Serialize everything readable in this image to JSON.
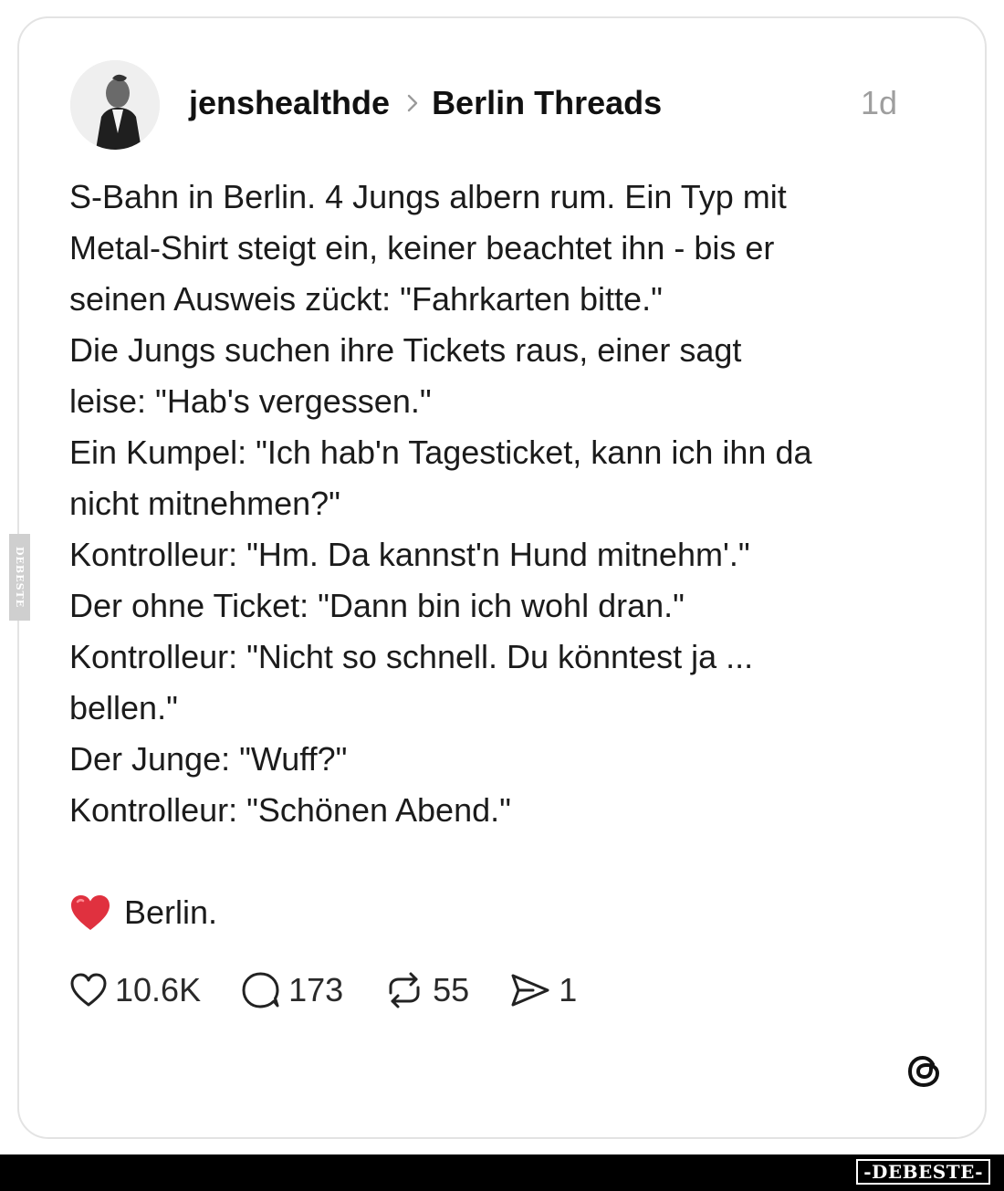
{
  "post": {
    "author": "jenshealthde",
    "community": "Berlin Threads",
    "timestamp": "1d",
    "lines": [
      "S-Bahn in Berlin. 4 Jungs albern rum. Ein Typ mit",
      "Metal-Shirt steigt ein, keiner beachtet ihn - bis er",
      "seinen Ausweis zückt: \"Fahrkarten bitte.\"",
      "Die Jungs suchen ihre Tickets raus, einer sagt",
      "leise: \"Hab's vergessen.\"",
      "Ein Kumpel: \"Ich hab'n Tagesticket, kann ich ihn da",
      "nicht mitnehmen?\"",
      "Kontrolleur: \"Hm. Da kannst'n Hund mitnehm'.\"",
      "Der ohne Ticket: \"Dann bin ich wohl dran.\"",
      "Kontrolleur: \"Nicht so schnell. Du könntest ja ...",
      "bellen.\"",
      "Der Junge: \"Wuff?\"",
      "Kontrolleur: \"Schönen Abend.\""
    ],
    "signoff": "Berlin.",
    "signoff_emoji": "red-heart-emoji"
  },
  "actions": {
    "likes": "10.6K",
    "comments": "173",
    "reposts": "55",
    "shares": "1"
  },
  "icons": {
    "like": "heart-icon",
    "comment": "comment-bubble-icon",
    "repost": "repost-icon",
    "share": "send-icon",
    "platform": "threads-logo-icon"
  },
  "watermark": {
    "side": "DEBESTE",
    "brand": "-DEBESTE-"
  },
  "colors": {
    "heart": "#e0313f",
    "muted": "#9e9e9e",
    "text": "#1b1b1b"
  }
}
